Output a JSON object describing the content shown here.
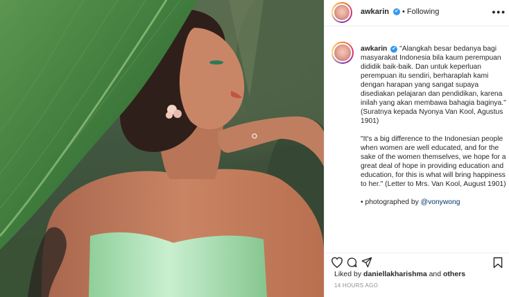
{
  "post": {
    "username": "awkarin",
    "follow_status": "Following",
    "caption_username": "awkarin",
    "caption_indonesian": "\"Alangkah besar bedanya bagi masyarakat Indonesia bila kaum perempuan dididik baik-baik. Dan untuk keperluan perempuan itu sendiri, berharaplah kami dengan harapan yang sangat supaya disediakan pelajaran dan pendidikan, karena inilah yang akan membawa bahagia baginya.\" (Suratnya kepada Nyonya Van Kool, Agustus 1901)",
    "caption_english": "\"It's a big difference to the Indonesian people when women are well educated, and for the sake of the women themselves, we hope for a great deal of hope in providing education and education, for this is what will bring happiness to her.\" (Letter to Mrs. Van Kool, August 1901)",
    "photographer_prefix": "• photographed by ",
    "photographer_handle": "@vonywong",
    "liked_by_prefix": "Liked by ",
    "liked_by_user": "daniellakharishma",
    "liked_by_and": " and ",
    "liked_by_others": "others",
    "timestamp": "14 HOURS AGO"
  },
  "icons": {
    "more": "more-options-icon",
    "verified": "verified-badge-icon",
    "like": "heart-icon",
    "comment": "comment-icon",
    "share": "share-icon",
    "save": "bookmark-icon"
  },
  "colors": {
    "verified_blue": "#3897f0",
    "mention_blue": "#003569",
    "muted_gray": "#8e8e8e",
    "dress_green": "#9fd8a8",
    "leaf_green": "#3f7a3a"
  }
}
